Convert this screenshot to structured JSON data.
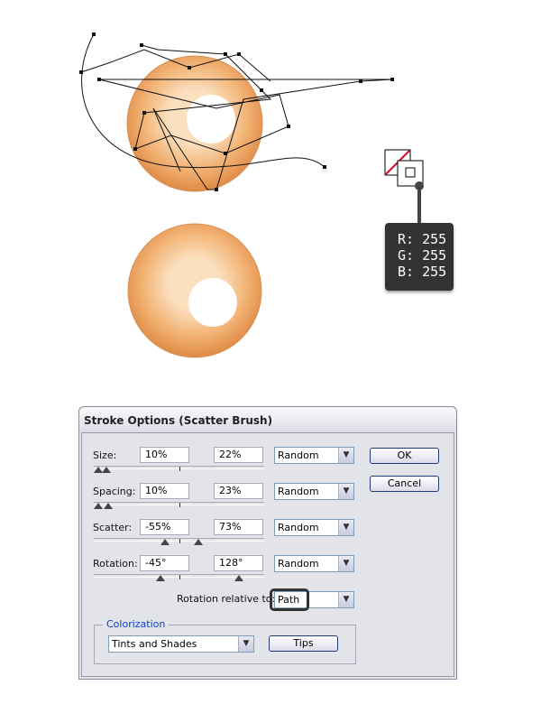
{
  "tooltip": {
    "r": "R: 255",
    "g": "G: 255",
    "b": "B: 255"
  },
  "dialog": {
    "title": "Stroke Options (Scatter Brush)",
    "rows": [
      {
        "label": "Size:",
        "min": "10%",
        "max": "22%",
        "mode": "Random"
      },
      {
        "label": "Spacing:",
        "min": "10%",
        "max": "23%",
        "mode": "Random"
      },
      {
        "label": "Scatter:",
        "min": "-55%",
        "max": "73%",
        "mode": "Random"
      },
      {
        "label": "Rotation:",
        "min": "-45°",
        "max": "128°",
        "mode": "Random"
      }
    ],
    "rotation_relative_label": "Rotation relative to:",
    "rotation_relative_value": "Path",
    "colorization_label": "Colorization",
    "colorization_value": "Tints and Shades",
    "ok": "OK",
    "cancel": "Cancel",
    "tips": "Tips",
    "accent": "#0a3fc7"
  }
}
